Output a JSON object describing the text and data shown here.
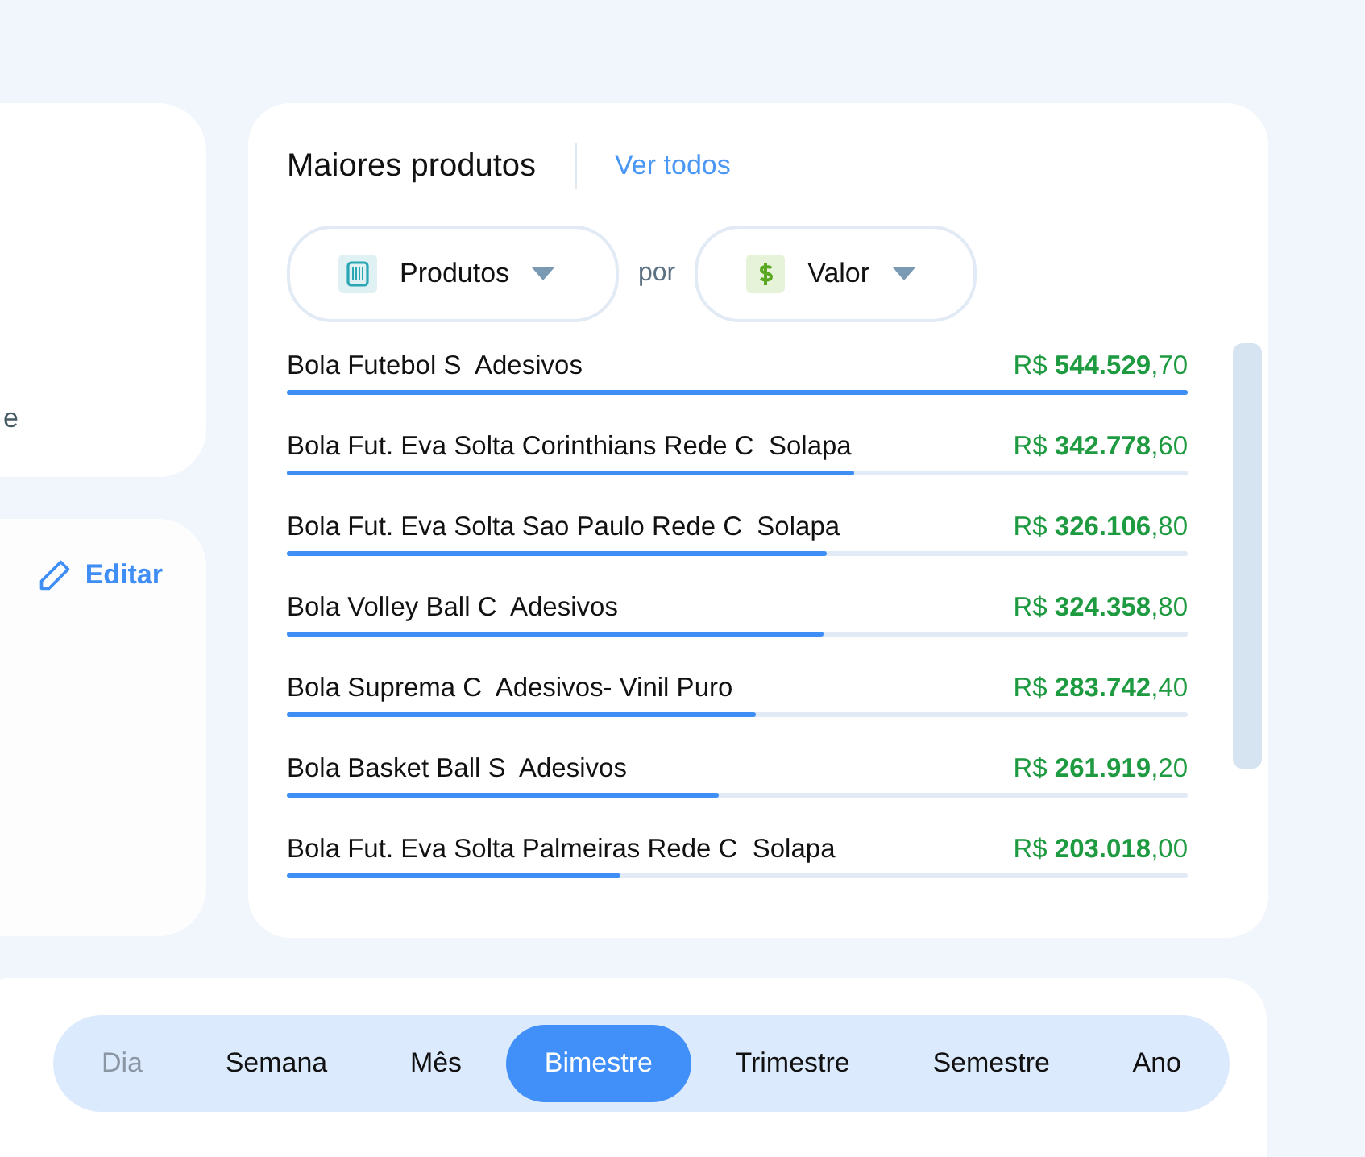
{
  "left_cards": [
    {
      "fragment": "e"
    },
    {
      "edit_label": "Editar"
    }
  ],
  "top_products": {
    "title": "Maiores produtos",
    "view_all": "Ver todos",
    "filters": [
      {
        "kind": "barcode",
        "label": "Produtos"
      },
      {
        "kind": "dollar",
        "label": "Valor"
      }
    ],
    "joiner": "por",
    "items": [
      {
        "name": "Bola Futebol S  Adesivos",
        "amount": "R$ **544.529**,70",
        "level": 1
      },
      {
        "name": "Bola Fut. Eva Solta Corinthians Rede C  Solapa",
        "amount": "R$ **342.778**,60",
        "level": 0.63
      },
      {
        "name": "Bola Fut. Eva Solta Sao Paulo Rede C  Solapa",
        "amount": "R$ **326.106**,80",
        "level": 0.6
      },
      {
        "name": "Bola Volley Ball C  Adesivos",
        "amount": "R$ **324.358**,80",
        "level": 0.596
      },
      {
        "name": "Bola Suprema C  Adesivos- Vinil Puro",
        "amount": "R$ **283.742**,40",
        "level": 0.52
      },
      {
        "name": "Bola Basket Ball S  Adesivos",
        "amount": "R$ **261.919**,20",
        "level": 0.48
      },
      {
        "name": "Bola Fut. Eva Solta Palmeiras Rede C  Solapa",
        "amount": "R$ **203.018**,00",
        "level": 0.37
      }
    ]
  },
  "periods": [
    {
      "label": "Dia",
      "selected": false,
      "disabled": true
    },
    {
      "label": "Semana",
      "selected": false,
      "disabled": false
    },
    {
      "label": "Mês",
      "selected": false,
      "disabled": false
    },
    {
      "label": "Bimestre",
      "selected": true,
      "disabled": false
    },
    {
      "label": "Trimestre",
      "selected": false,
      "disabled": false
    },
    {
      "label": "Semestre",
      "selected": false,
      "disabled": false
    },
    {
      "label": "Ano",
      "selected": false,
      "disabled": false
    }
  ]
}
